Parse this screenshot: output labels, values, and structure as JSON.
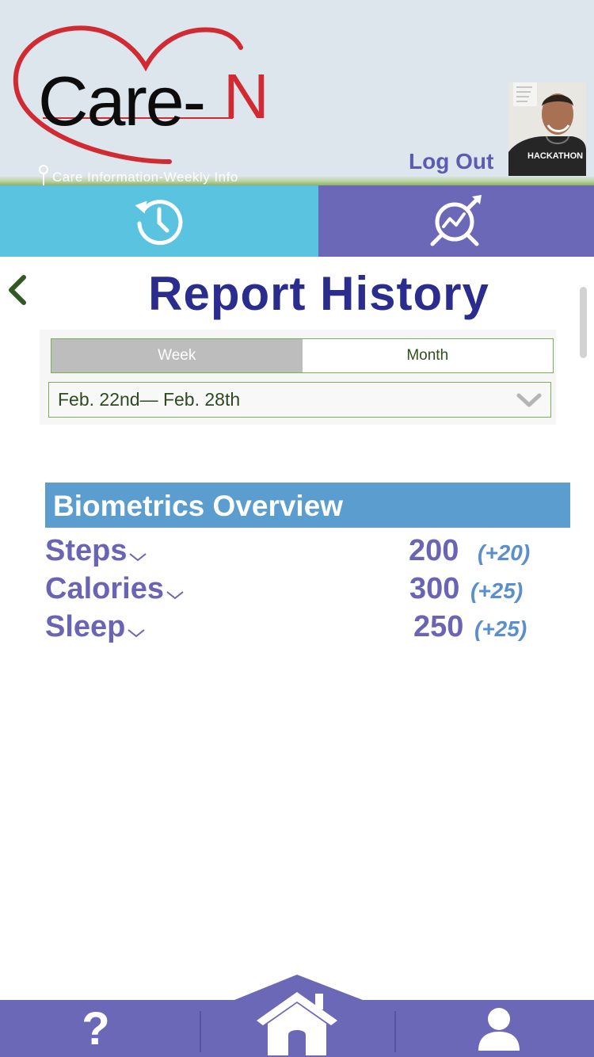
{
  "header": {
    "brand_word": "Care-",
    "brand_letter": "N",
    "tagline": "Care Information-Weekly Info",
    "logout_label": "Log Out",
    "avatar_shirt_text": "HACKATHON"
  },
  "tabs": [
    {
      "name": "history",
      "icon": "history-clock-icon",
      "color": "#59c3e0"
    },
    {
      "name": "analytics",
      "icon": "trend-analysis-icon",
      "color": "#6b68b8"
    }
  ],
  "main": {
    "title": "Report History",
    "period_toggle": {
      "options": [
        "Week",
        "Month"
      ],
      "selected": "Week"
    },
    "date_range": "Feb. 22nd— Feb. 28th",
    "section_title": "Biometrics Overview",
    "metrics": [
      {
        "label": "Steps",
        "value": "200",
        "delta": "(+20)"
      },
      {
        "label": "Calories",
        "value": "300",
        "delta": "(+25)"
      },
      {
        "label": "Sleep",
        "value": "250",
        "delta": "(+25)"
      }
    ]
  },
  "bottom_nav": {
    "help_glyph": "?",
    "items": [
      "help-icon",
      "home-icon",
      "profile-icon"
    ]
  },
  "colors": {
    "header_bg": "#dce6ec",
    "title": "#2a2d8e",
    "accent_purple": "#6b68b8",
    "accent_cyan": "#59c3e0",
    "section_blue": "#5b9dcf",
    "logo_red": "#d22a33",
    "border_green": "#7cae57"
  }
}
